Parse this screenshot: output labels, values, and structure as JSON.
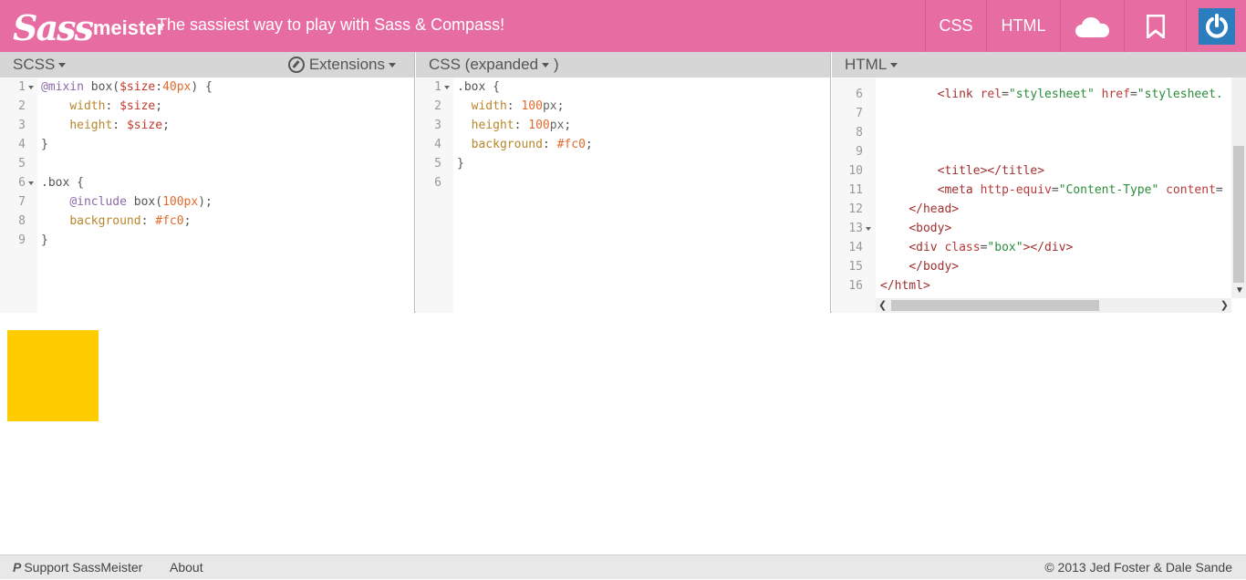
{
  "header": {
    "logo_sass": "Sass",
    "logo_meister": "meister",
    "tagline": "The sassiest way to play with Sass & Compass!",
    "nav": {
      "css": "CSS",
      "html": "HTML"
    },
    "icons": [
      "cloud-icon",
      "bookmark-icon",
      "power-icon"
    ],
    "color": "#e76ca1"
  },
  "panels": {
    "scss": {
      "title": "SCSS",
      "extensions": "Extensions"
    },
    "css": {
      "title": "CSS (expanded",
      "title_end": ")"
    },
    "html": {
      "title": "HTML"
    }
  },
  "scss_lines": [
    {
      "n": "1",
      "code": "@mixin box($size:40px) {"
    },
    {
      "n": "2",
      "code": "width: $size;"
    },
    {
      "n": "3",
      "code": "height: $size;"
    },
    {
      "n": "4",
      "code": "}"
    },
    {
      "n": "5",
      "code": ""
    },
    {
      "n": "6",
      "code": ".box {"
    },
    {
      "n": "7",
      "code": "@include box(100px);"
    },
    {
      "n": "8",
      "code": "background: #fc0;"
    },
    {
      "n": "9",
      "code": "}"
    }
  ],
  "css_lines": [
    {
      "n": "1",
      "code": ".box {"
    },
    {
      "n": "2",
      "code": "width: 100px;"
    },
    {
      "n": "3",
      "code": "height: 100px;"
    },
    {
      "n": "4",
      "code": "background: #fc0;"
    },
    {
      "n": "5",
      "code": "}"
    },
    {
      "n": "6",
      "code": ""
    }
  ],
  "html_lines": [
    {
      "n": "6",
      "code": "<link rel=\"stylesheet\" href=\"stylesheet."
    },
    {
      "n": "7",
      "code": ""
    },
    {
      "n": "8",
      "code": ""
    },
    {
      "n": "9",
      "code": ""
    },
    {
      "n": "10",
      "code": "<title></title>"
    },
    {
      "n": "11",
      "code": "<meta http-equiv=\"Content-Type\" content="
    },
    {
      "n": "12",
      "code": "</head>"
    },
    {
      "n": "13",
      "code": "<body>"
    },
    {
      "n": "14",
      "code": "<div class=\"box\"></div>"
    },
    {
      "n": "15",
      "code": "</body>"
    },
    {
      "n": "16",
      "code": "</html>"
    }
  ],
  "preview": {
    "box_color": "#ffcc00"
  },
  "footer": {
    "support": "Support SassMeister",
    "about": "About",
    "copyright": "© 2013 Jed Foster & Dale Sande"
  }
}
